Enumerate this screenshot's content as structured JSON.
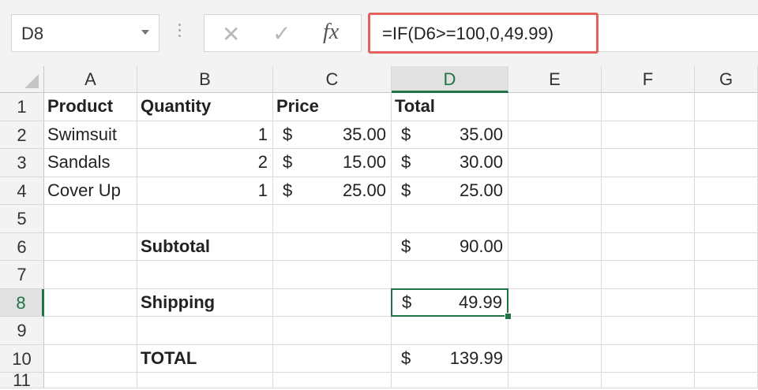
{
  "name_box": {
    "value": "D8"
  },
  "formula_bar": {
    "cancel_icon": "✕",
    "enter_icon": "✓",
    "fx_label": "fx",
    "formula": "=IF(D6>=100,0,49.99)"
  },
  "columns": [
    "A",
    "B",
    "C",
    "D",
    "E",
    "F",
    "G"
  ],
  "rows": [
    "1",
    "2",
    "3",
    "4",
    "5",
    "6",
    "7",
    "8",
    "9",
    "10",
    "11"
  ],
  "cells": {
    "A1": "Product",
    "B1": "Quantity",
    "C1": "Price",
    "D1": "Total",
    "A2": "Swimsuit",
    "B2": "1",
    "C2_cur": "$",
    "C2": "35.00",
    "D2_cur": "$",
    "D2": "35.00",
    "A3": "Sandals",
    "B3": "2",
    "C3_cur": "$",
    "C3": "15.00",
    "D3_cur": "$",
    "D3": "30.00",
    "A4": "Cover Up",
    "B4": "1",
    "C4_cur": "$",
    "C4": "25.00",
    "D4_cur": "$",
    "D4": "25.00",
    "B6": "Subtotal",
    "D6_cur": "$",
    "D6": "90.00",
    "B8": "Shipping",
    "D8_cur": "$",
    "D8": "49.99",
    "B10": "TOTAL",
    "D10_cur": "$",
    "D10": "139.99"
  },
  "selection": {
    "active_cell": "D8",
    "active_column": "D",
    "active_row": "8"
  },
  "colors": {
    "selection": "#217346",
    "highlight_box": "#e2615a"
  }
}
